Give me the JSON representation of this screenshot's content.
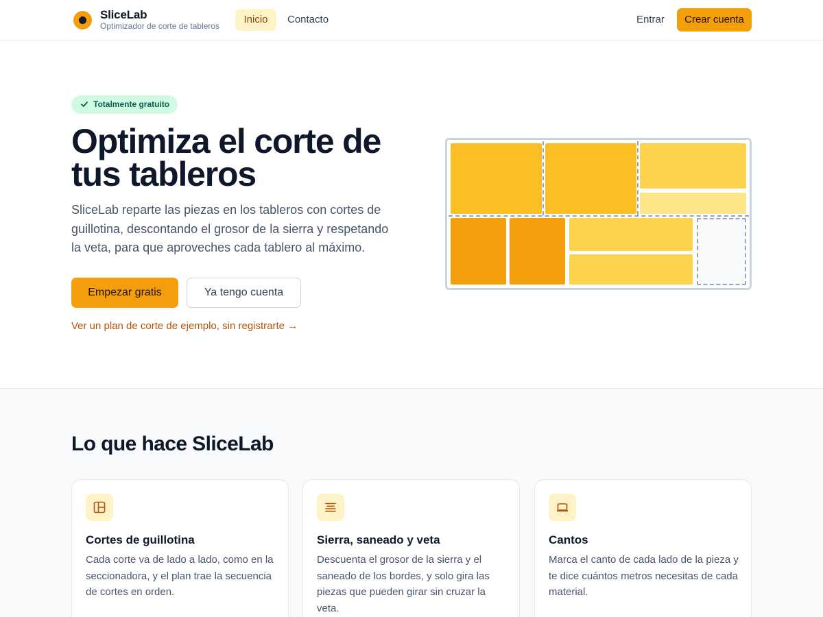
{
  "header": {
    "brand_name": "SliceLab",
    "brand_tagline": "Optimizador de corte de tableros",
    "nav": [
      {
        "label": "Inicio",
        "active": true
      },
      {
        "label": "Contacto",
        "active": false
      }
    ],
    "login_label": "Entrar",
    "signup_label": "Crear cuenta"
  },
  "hero": {
    "badge": "Totalmente gratuito",
    "title": "Optimiza el corte de tus tableros",
    "description": "SliceLab reparte las piezas en los tableros con cortes de guillotina, descontando el grosor de la sierra y respetando la veta, para que aproveches cada tablero al máximo.",
    "primary_cta": "Empezar gratis",
    "secondary_cta": "Ya tengo cuenta",
    "example_link": "Ver un plan de corte de ejemplo, sin registrarte →"
  },
  "features": {
    "title": "Lo que hace SliceLab",
    "cards": [
      {
        "icon": "layout-icon",
        "title": "Cortes de guillotina",
        "text": "Cada corte va de lado a lado, como en la seccionadora, y el plan trae la secuencia de cortes en orden."
      },
      {
        "icon": "lines-icon",
        "title": "Sierra, saneado y veta",
        "text": "Descuenta el grosor de la sierra y el saneado de los bordes, y solo gira las piezas que pueden girar sin cruzar la veta."
      },
      {
        "icon": "edge-banding-icon",
        "title": "Cantos",
        "text": "Marca el canto de cada lado de la pieza y te dice cuántos metros necesitas de cada material."
      }
    ]
  },
  "colors": {
    "accent": "#f59e0b",
    "accent_soft": "#fef3c7",
    "link": "#b45309",
    "badge_bg": "#d1fae5",
    "badge_text": "#065f46"
  }
}
